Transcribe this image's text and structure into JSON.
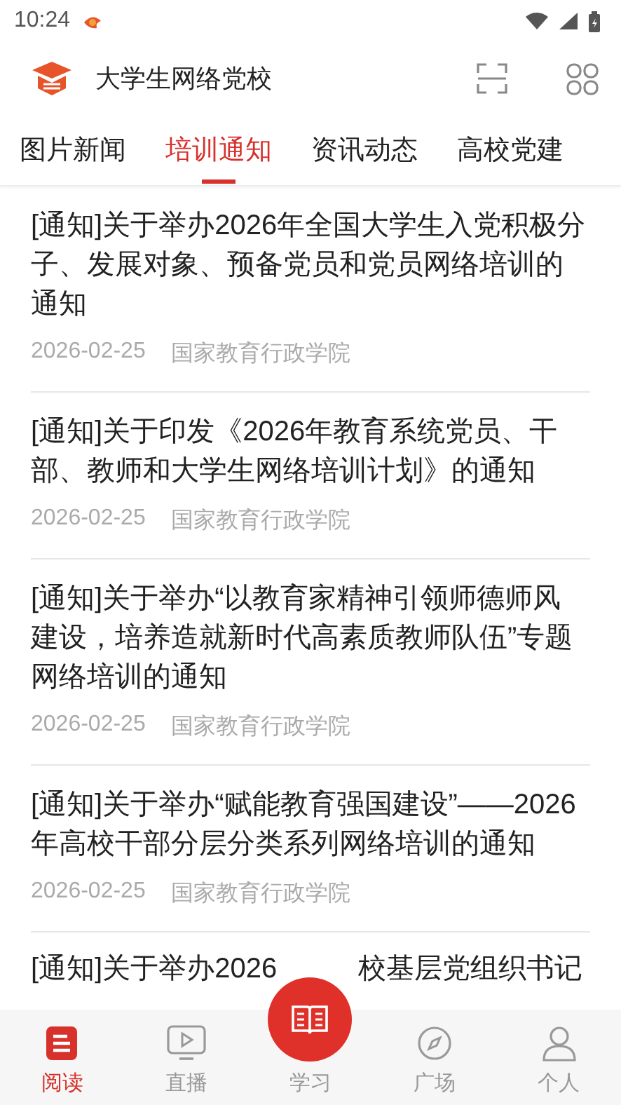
{
  "status_bar": {
    "time": "10:24"
  },
  "header": {
    "title": "大学生网络党校"
  },
  "tabs": [
    {
      "label": "图片新闻",
      "selected": false
    },
    {
      "label": "培训通知",
      "selected": true
    },
    {
      "label": "资讯动态",
      "selected": false
    },
    {
      "label": "高校党建",
      "selected": false
    }
  ],
  "articles": [
    {
      "title": "[通知]关于举办2026年全国大学生入党积极分子、发展对象、预备党员和党员网络培训的通知",
      "date": "2026-02-25",
      "source": "国家教育行政学院"
    },
    {
      "title": "[通知]关于印发《2026年教育系统党员、干部、教师和大学生网络培训计划》的通知",
      "date": "2026-02-25",
      "source": "国家教育行政学院"
    },
    {
      "title": "[通知]关于举办“以教育家精神引领师德师风建设，培养造就新时代高素质教师队伍”专题网络培训的通知",
      "date": "2026-02-25",
      "source": "国家教育行政学院"
    },
    {
      "title": "[通知]关于举办“赋能教育强国建设”——2026年高校干部分层分类系列网络培训的通知",
      "date": "2026-02-25",
      "source": "国家教育行政学院"
    },
    {
      "title_parts": [
        "[通知]关于举办2026",
        "校基层党组织书记"
      ]
    }
  ],
  "bottom_nav": [
    {
      "label": "阅读",
      "kind": "read",
      "selected": true
    },
    {
      "label": "直播",
      "kind": "live",
      "selected": false
    },
    {
      "label": "学习",
      "kind": "study",
      "selected": false
    },
    {
      "label": "广场",
      "kind": "square",
      "selected": false
    },
    {
      "label": "个人",
      "kind": "person",
      "selected": false
    }
  ]
}
